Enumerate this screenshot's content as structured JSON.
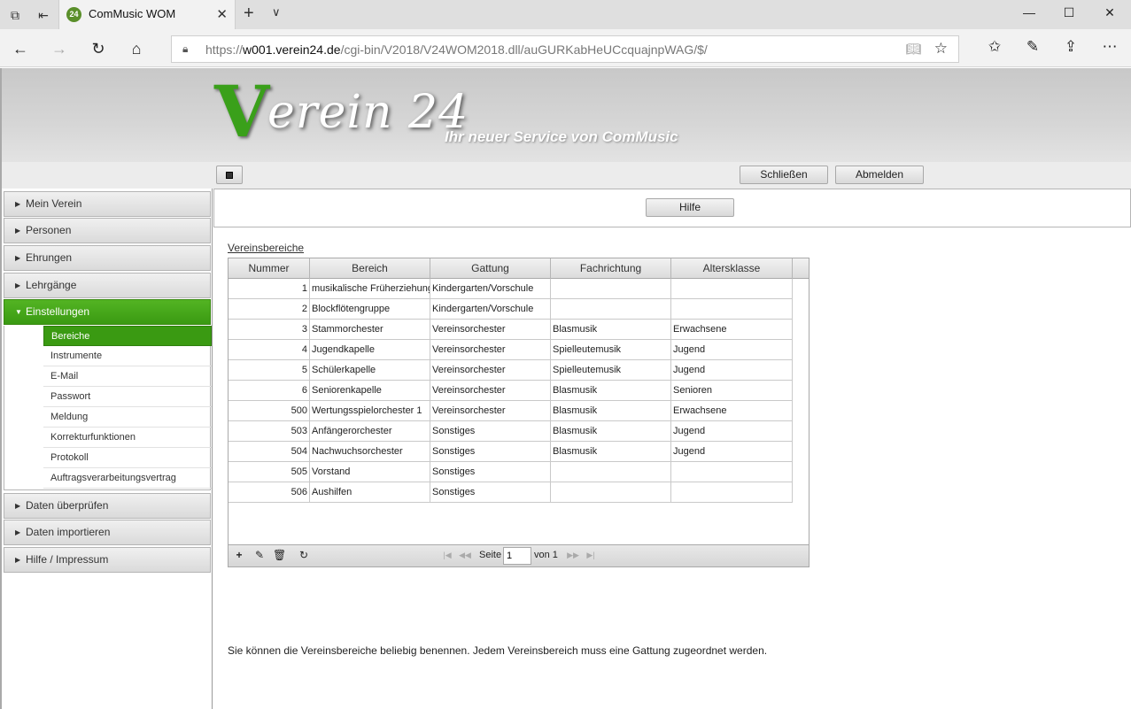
{
  "browser": {
    "tab_title": "ComMusic WOM",
    "tab_favicon": "24",
    "url_prefix": "https://",
    "url_host": "w001.verein24.de",
    "url_path": "/cgi-bin/V2018/V24WOM2018.dll/auGURKabHeUCcquajnpWAG/$/"
  },
  "header": {
    "logo_v": "V",
    "logo_rest": "erein 24",
    "slogan": "Ihr neuer Service von ComMusic",
    "close_label": "Schließen",
    "logout_label": "Abmelden"
  },
  "sidebar": {
    "items": [
      {
        "label": "Mein Verein"
      },
      {
        "label": "Personen"
      },
      {
        "label": "Ehrungen"
      },
      {
        "label": "Lehrgänge"
      },
      {
        "label": "Einstellungen"
      },
      {
        "label": "Daten überprüfen"
      },
      {
        "label": "Daten importieren"
      },
      {
        "label": "Hilfe / Impressum"
      }
    ],
    "subitems": [
      {
        "label": "Bereiche"
      },
      {
        "label": "Instrumente"
      },
      {
        "label": "E-Mail"
      },
      {
        "label": "Passwort"
      },
      {
        "label": "Meldung"
      },
      {
        "label": "Korrekturfunktionen"
      },
      {
        "label": "Protokoll"
      },
      {
        "label": "Auftragsverarbeitungsvertrag"
      }
    ]
  },
  "main": {
    "help_label": "Hilfe",
    "section_title": "Vereinsbereiche",
    "columns": [
      "Nummer",
      "Bereich",
      "Gattung",
      "Fachrichtung",
      "Altersklasse"
    ],
    "rows": [
      [
        "1",
        "musikalische Früherziehung",
        "Kindergarten/Vorschule",
        "",
        ""
      ],
      [
        "2",
        "Blockflötengruppe",
        "Kindergarten/Vorschule",
        "",
        ""
      ],
      [
        "3",
        "Stammorchester",
        "Vereinsorchester",
        "Blasmusik",
        "Erwachsene"
      ],
      [
        "4",
        "Jugendkapelle",
        "Vereinsorchester",
        "Spielleutemusik",
        "Jugend"
      ],
      [
        "5",
        "Schülerkapelle",
        "Vereinsorchester",
        "Spielleutemusik",
        "Jugend"
      ],
      [
        "6",
        "Seniorenkapelle",
        "Vereinsorchester",
        "Blasmusik",
        "Senioren"
      ],
      [
        "500",
        "Wertungsspielorchester 1",
        "Vereinsorchester",
        "Blasmusik",
        "Erwachsene"
      ],
      [
        "503",
        "Anfängerorchester",
        "Sonstiges",
        "Blasmusik",
        "Jugend"
      ],
      [
        "504",
        "Nachwuchsorchester",
        "Sonstiges",
        "Blasmusik",
        "Jugend"
      ],
      [
        "505",
        "Vorstand",
        "Sonstiges",
        "",
        ""
      ],
      [
        "506",
        "Aushilfen",
        "Sonstiges",
        "",
        ""
      ]
    ],
    "pager": {
      "page_label": "Seite",
      "page_value": "1",
      "of_label": "von 1"
    },
    "info_text": "Sie können die Vereinsbereiche beliebig benennen. Jedem Vereinsbereich muss eine Gattung zugeordnet werden."
  }
}
